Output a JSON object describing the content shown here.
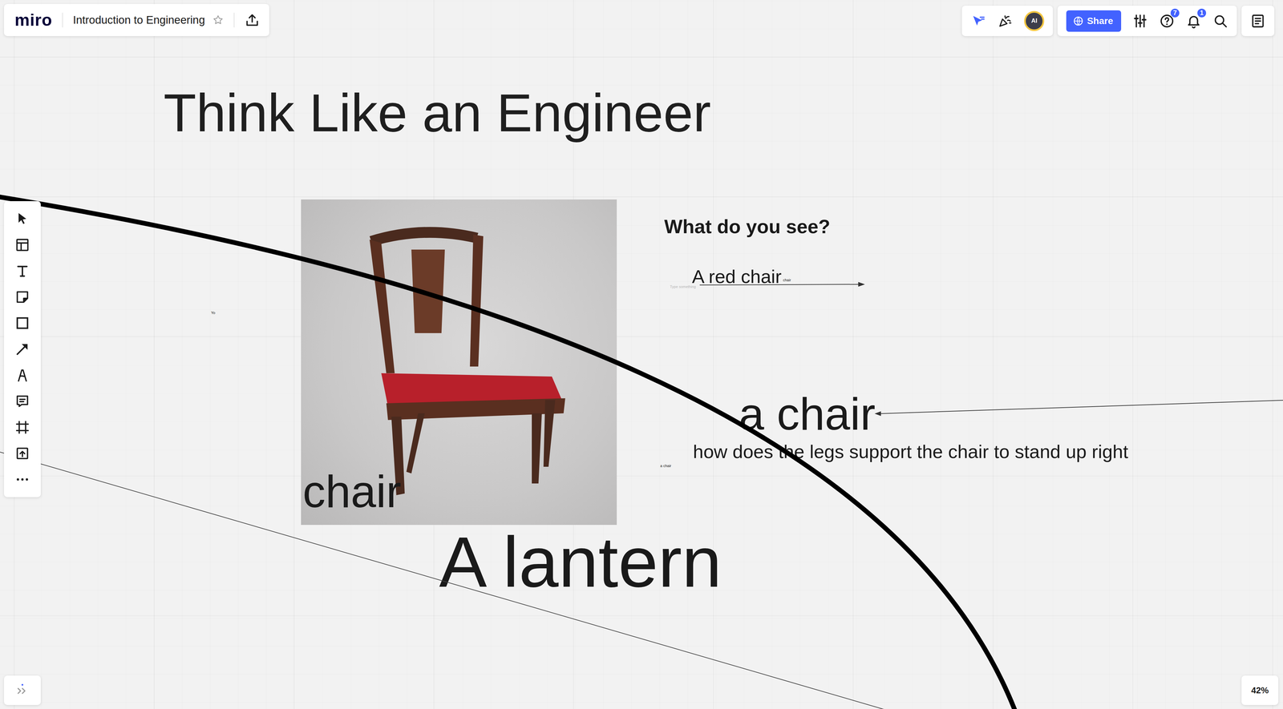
{
  "board": {
    "logo": "miro",
    "title": "Introduction to Engineering",
    "starred": false
  },
  "topbar": {
    "avatar": "AI",
    "share": "Share",
    "help_badge": "7",
    "notifications_badge": "1"
  },
  "zoom": "42%",
  "canvas": {
    "heading": "Think Like an Engineer",
    "prompt": "What do you see?",
    "answer": "A red chair",
    "answer_tag": "chair",
    "placeholder": "Type something",
    "big_answer": "a chair",
    "question": "how does the legs support the chair to stand up right",
    "small_note": "a chair",
    "stray_note": "Yo",
    "image_label": "chair",
    "lantern": "A lantern"
  }
}
